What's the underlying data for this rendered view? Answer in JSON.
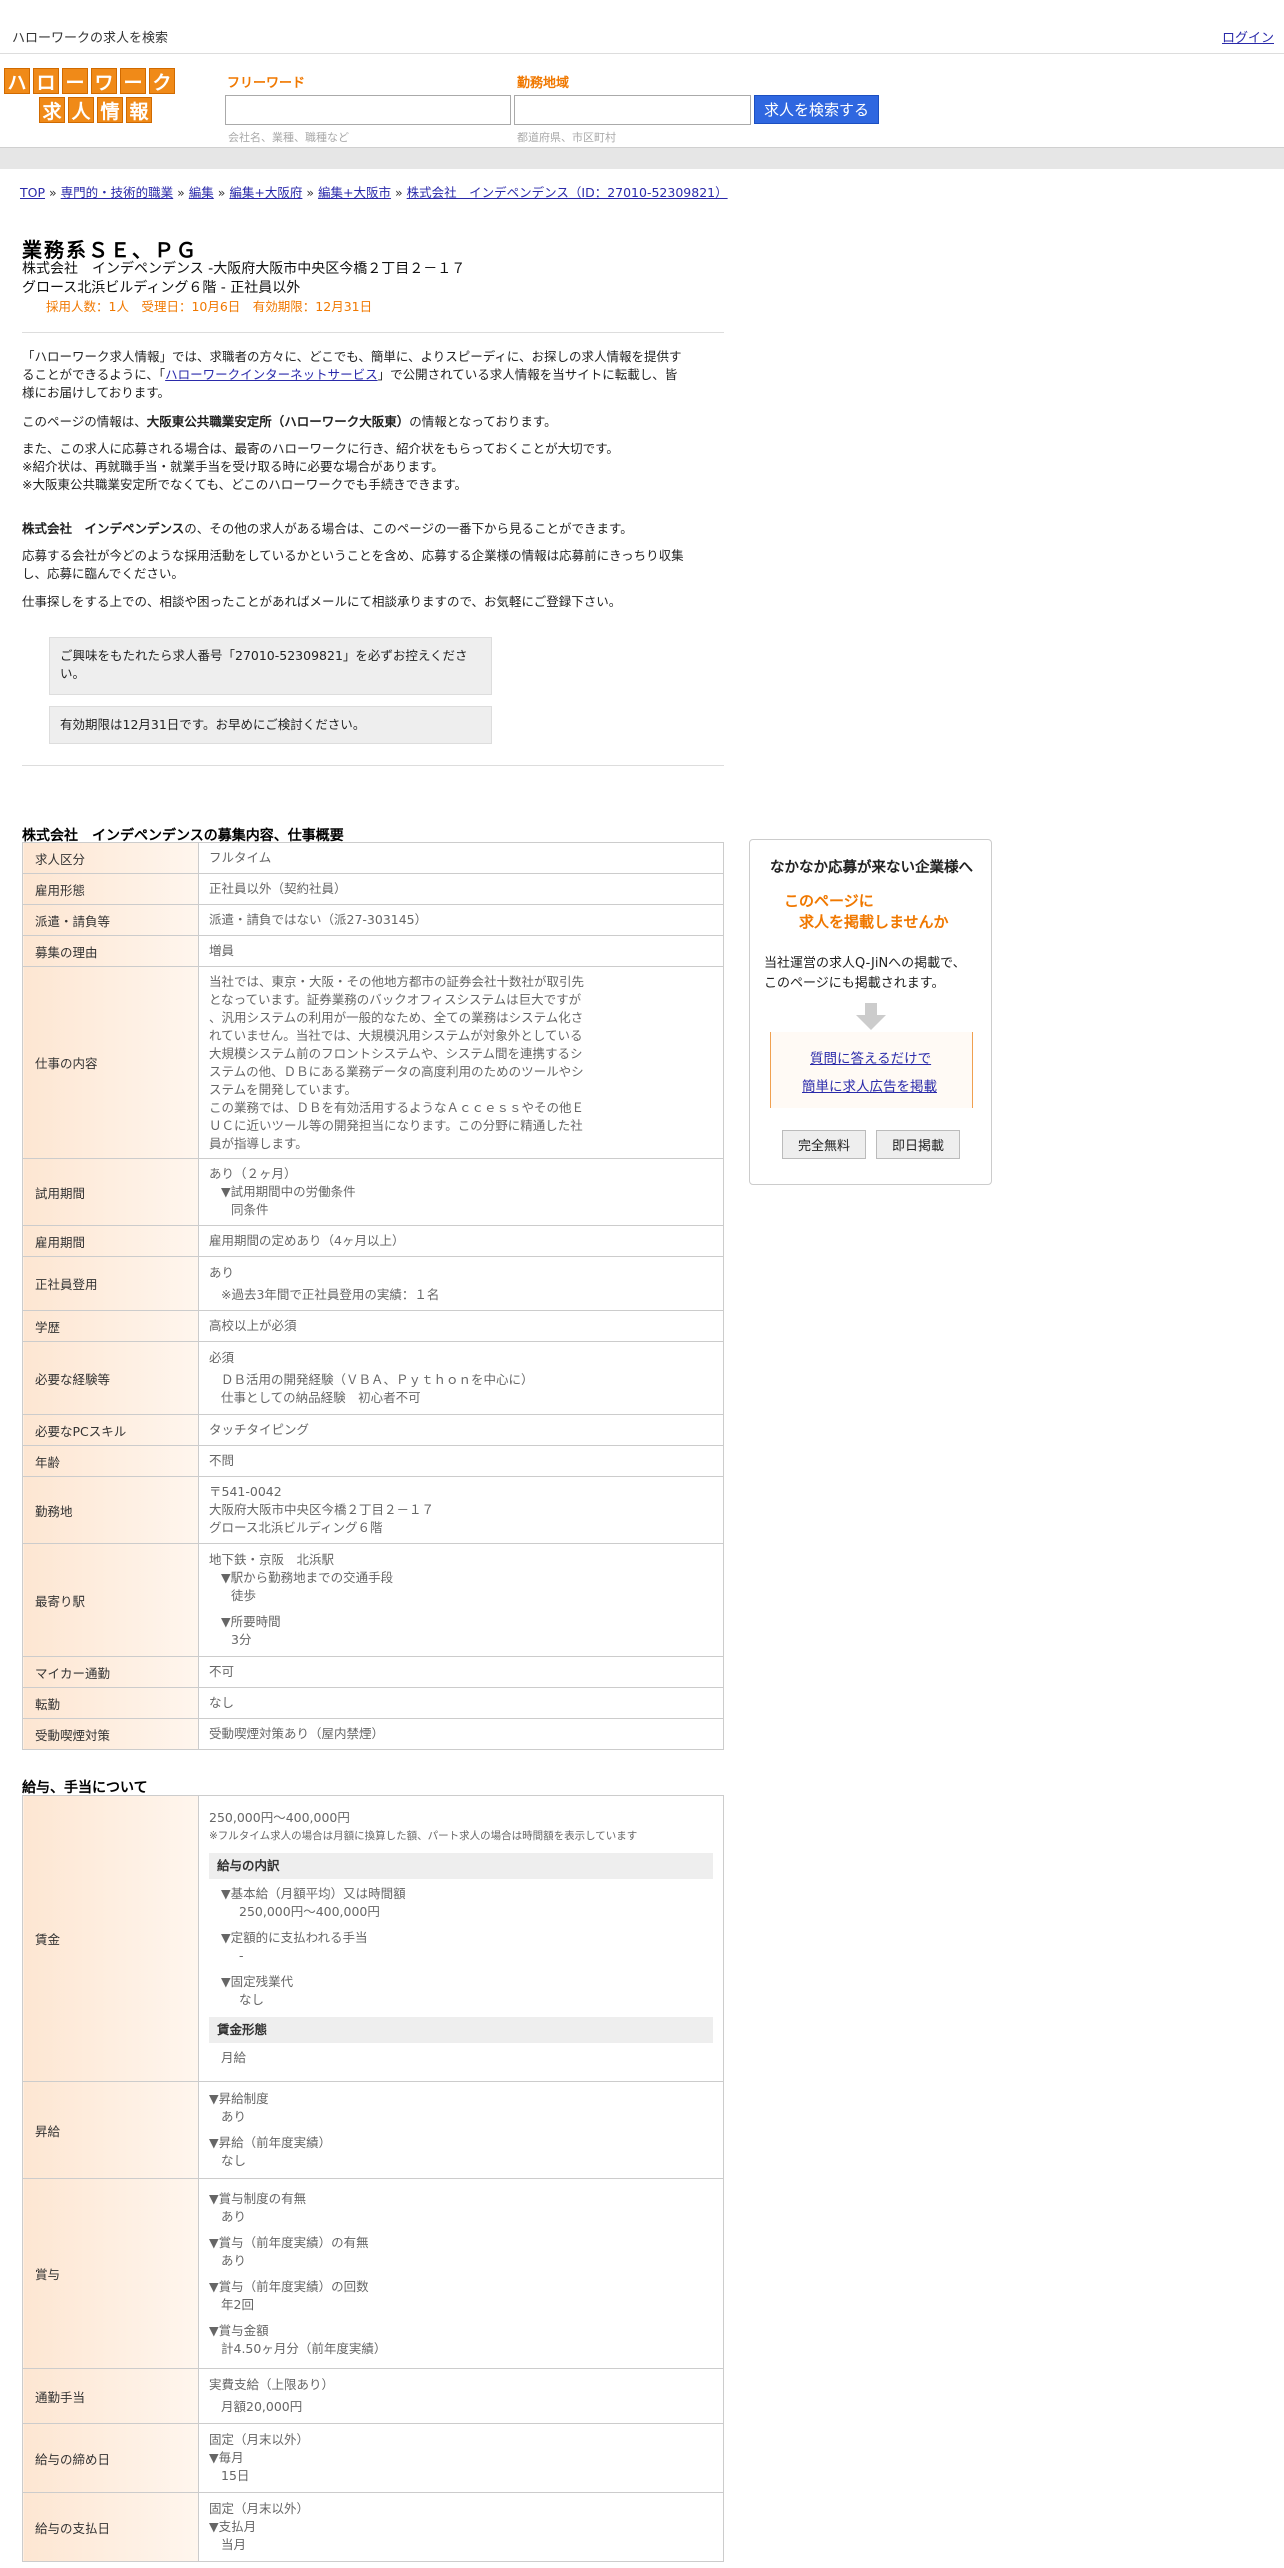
{
  "top": {
    "site_title": "ハローワークの求人を検索",
    "login": "ログイン"
  },
  "logo": {
    "row1": [
      "ハ",
      "ロ",
      "ー",
      "ワ",
      "ー",
      "ク"
    ],
    "row2": [
      "求",
      "人",
      "情",
      "報"
    ]
  },
  "search": {
    "keyword_label": "フリーワード",
    "keyword_placeholder": "会社名、業種、職種など",
    "area_label": "勤務地域",
    "area_placeholder": "都道府県、市区町村",
    "button": "求人を検索する"
  },
  "breadcrumb": [
    {
      "label": "TOP"
    },
    {
      "label": "専門的・技術的職業"
    },
    {
      "label": "編集"
    },
    {
      "label": "編集+大阪府"
    },
    {
      "label": "編集+大阪市"
    },
    {
      "label": "株式会社　インデペンデンス（ID：27010-52309821）"
    }
  ],
  "job": {
    "title": "業務系ＳＥ、ＰＧ",
    "company_line": "株式会社　インデペンデンス -大阪府大阪市中央区今橋２丁目２－１７",
    "building_line": "グロース北浜ビルディング６階 - 正社員以外",
    "meta": "採用人数：1人　受理日：10月6日　有効期限：12月31日"
  },
  "intro": {
    "p1_a": "「ハローワーク求人情報」では、求職者の方々に、どこでも、簡単に、よりスピーディに、お探しの求人情報を提供す",
    "p1_b": "ることができるように、「",
    "p1_link": "ハローワークインターネットサービス",
    "p1_c": "」で公開されている求人情報を当サイトに転載し、皆",
    "p1_d": "様にお届けしております。",
    "p2_a": "このページの情報は、",
    "p2_bold": "大阪東公共職業安定所（ハローワーク大阪東）",
    "p2_b": "の情報となっております。",
    "p3_1": "また、この求人に応募される場合は、最寄のハローワークに行き、紹介状をもらっておくことが大切です。",
    "p3_2": "※紹介状は、再就職手当・就業手当を受け取る時に必要な場合があります。",
    "p3_3": "※大阪東公共職業安定所でなくても、どこのハローワークでも手続きできます。",
    "p4_bold": "株式会社　インデペンデンス",
    "p4_rest": "の、その他の求人がある場合は、このページの一番下から見ることができます。",
    "p5_1": "応募する会社が今どのような採用活動をしているかということを含め、応募する企業様の情報は応募前にきっちり収集",
    "p5_2": "し、応募に臨んでください。",
    "p6": "仕事探しをする上での、相談や困ったことがあればメールにて相談承りますので、お気軽にご登録下さい。",
    "note1_a": "ご興味をもたれたら求人番号「27010-52309821」を必ずお控えくださ",
    "note1_b": "い。",
    "note2": "有効期限は12月31日です。お早めにご検討ください。"
  },
  "section1": {
    "title": "株式会社　インデペンデンスの募集内容、仕事概要",
    "rows": {
      "r1": {
        "k": "求人区分",
        "v": "フルタイム"
      },
      "r2": {
        "k": "雇用形態",
        "v": "正社員以外（契約社員）"
      },
      "r3": {
        "k": "派遣・請負等",
        "v": "派遣・請負ではない（派27-303145）"
      },
      "r4": {
        "k": "募集の理由",
        "v": "増員"
      },
      "r5": {
        "k": "仕事の内容",
        "lines": [
          "当社では、東京・大阪・その他地方都市の証券会社十数社が取引先",
          "となっています。証券業務のバックオフィスシステムは巨大ですが",
          "、汎用システムの利用が一般的なため、全ての業務はシステム化さ",
          "れていません。当社では、大規模汎用システムが対象外としている",
          "大規模システム前のフロントシステムや、システム間を連携するシ",
          "ステムの他、ＤＢにある業務データの高度利用のためのツールやシ",
          "ステムを開発しています。",
          "この業務では、ＤＢを有効活用するようなＡｃｃｅｓｓやその他Ｅ",
          "ＵＣに近いツール等の開発担当になります。この分野に精通した社",
          "員が指導します。"
        ]
      },
      "r6": {
        "k": "試用期間",
        "a": "あり（２ヶ月）",
        "b": "▼試用期間中の労働条件",
        "c": "同条件"
      },
      "r7": {
        "k": "雇用期間",
        "v": "雇用期間の定めあり（4ヶ月以上）"
      },
      "r8": {
        "k": "正社員登用",
        "a": "あり",
        "b": "※過去3年間で正社員登用の実績：１名"
      },
      "r9": {
        "k": "学歴",
        "v": "高校以上が必須"
      },
      "r10": {
        "k": "必要な経験等",
        "a": "必須",
        "b": "ＤＢ活用の開発経験（ＶＢＡ、Ｐｙｔｈｏｎを中心に）",
        "c": "仕事としての納品経験　初心者不可"
      },
      "r11": {
        "k": "必要なPCスキル",
        "v": "タッチタイピング"
      },
      "r12": {
        "k": "年齢",
        "v": "不問"
      },
      "r13": {
        "k": "勤務地",
        "a": "〒541-0042",
        "b": "大阪府大阪市中央区今橋２丁目２－１７",
        "c": "グロース北浜ビルディング６階"
      },
      "r14": {
        "k": "最寄り駅",
        "a": "地下鉄・京阪　北浜駅",
        "b": "▼駅から勤務地までの交通手段",
        "c": "徒歩",
        "d": "▼所要時間",
        "e": "3分"
      },
      "r15": {
        "k": "マイカー通勤",
        "v": "不可"
      },
      "r16": {
        "k": "転勤",
        "v": "なし"
      },
      "r17": {
        "k": "受動喫煙対策",
        "v": "受動喫煙対策あり（屋内禁煙）"
      }
    }
  },
  "section2": {
    "title": "給与、手当について",
    "wage": {
      "k": "賃金",
      "range": "250,000円〜400,000円",
      "note": "※フルタイム求人の場合は月額に換算した額、パート求人の場合は時間額を表示しています",
      "breakdown_title": "給与の内訳",
      "b1": "▼基本給（月額平均）又は時間額",
      "b1v": "250,000円〜400,000円",
      "b2": "▼定額的に支払われる手当",
      "b2v": "-",
      "b3": "▼固定残業代",
      "b3v": "なし",
      "form_title": "賃金形態",
      "form": "月給"
    },
    "raise": {
      "k": "昇給",
      "a": "▼昇給制度",
      "av": "あり",
      "b": "▼昇給（前年度実績）",
      "bv": "なし"
    },
    "bonus": {
      "k": "賞与",
      "a": "▼賞与制度の有無",
      "av": "あり",
      "b": "▼賞与（前年度実績）の有無",
      "bv": "あり",
      "c": "▼賞与（前年度実績）の回数",
      "cv": "年2回",
      "d": "▼賞与金額",
      "dv": "計4.50ヶ月分（前年度実績）"
    },
    "commute": {
      "k": "通勤手当",
      "a": "実費支給（上限あり）",
      "b": "月額20,000円"
    },
    "closing": {
      "k": "給与の締め日",
      "a": "固定（月末以外）",
      "b": "▼毎月",
      "c": "15日"
    },
    "payday": {
      "k": "給与の支払日",
      "a": "固定（月末以外）",
      "b": "▼支払月",
      "c": "当月"
    }
  },
  "ad": {
    "heading": "なかなか応募が来ない企業様へ",
    "orange1": "このページに",
    "orange2": "求人を掲載しませんか",
    "desc1": "当社運営の求人Q-JiNへの掲載で、",
    "desc2": "このページにも掲載されます。",
    "link1": "質問に答えるだけで",
    "link2": "簡単に求人広告を掲載",
    "btn1": "完全無料",
    "btn2": "即日掲載"
  }
}
